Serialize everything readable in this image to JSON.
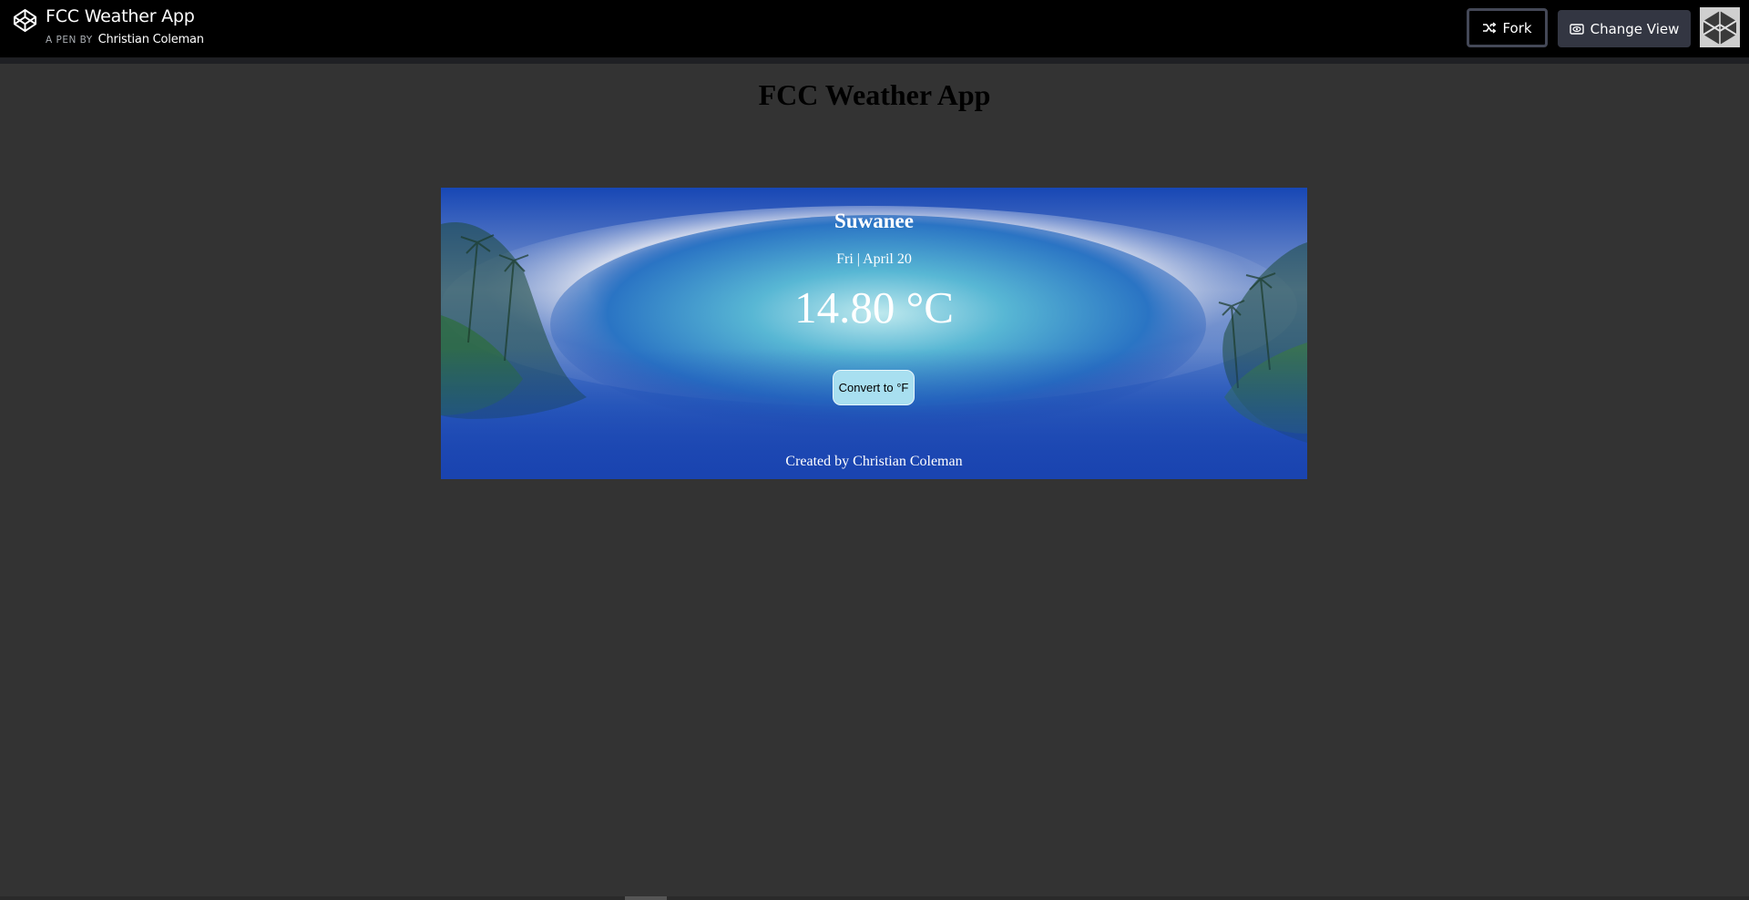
{
  "header": {
    "title": "FCC Weather App",
    "byline_prefix": "A PEN BY",
    "author": "Christian Coleman",
    "fork_label": "Fork",
    "change_view_label": "Change View",
    "logo_icon": "codepen-icon",
    "fork_icon": "fork-icon",
    "change_view_icon": "eye-icon"
  },
  "page": {
    "heading": "FCC Weather App"
  },
  "weather": {
    "city": "Suwanee",
    "date": "Fri | April 20",
    "temperature": "14.80 °C",
    "convert_label": "Convert to °F",
    "credit": "Created by Christian Coleman"
  },
  "colors": {
    "background": "#333333",
    "topbar": "#000000",
    "button_accent": "#a8dff0"
  }
}
